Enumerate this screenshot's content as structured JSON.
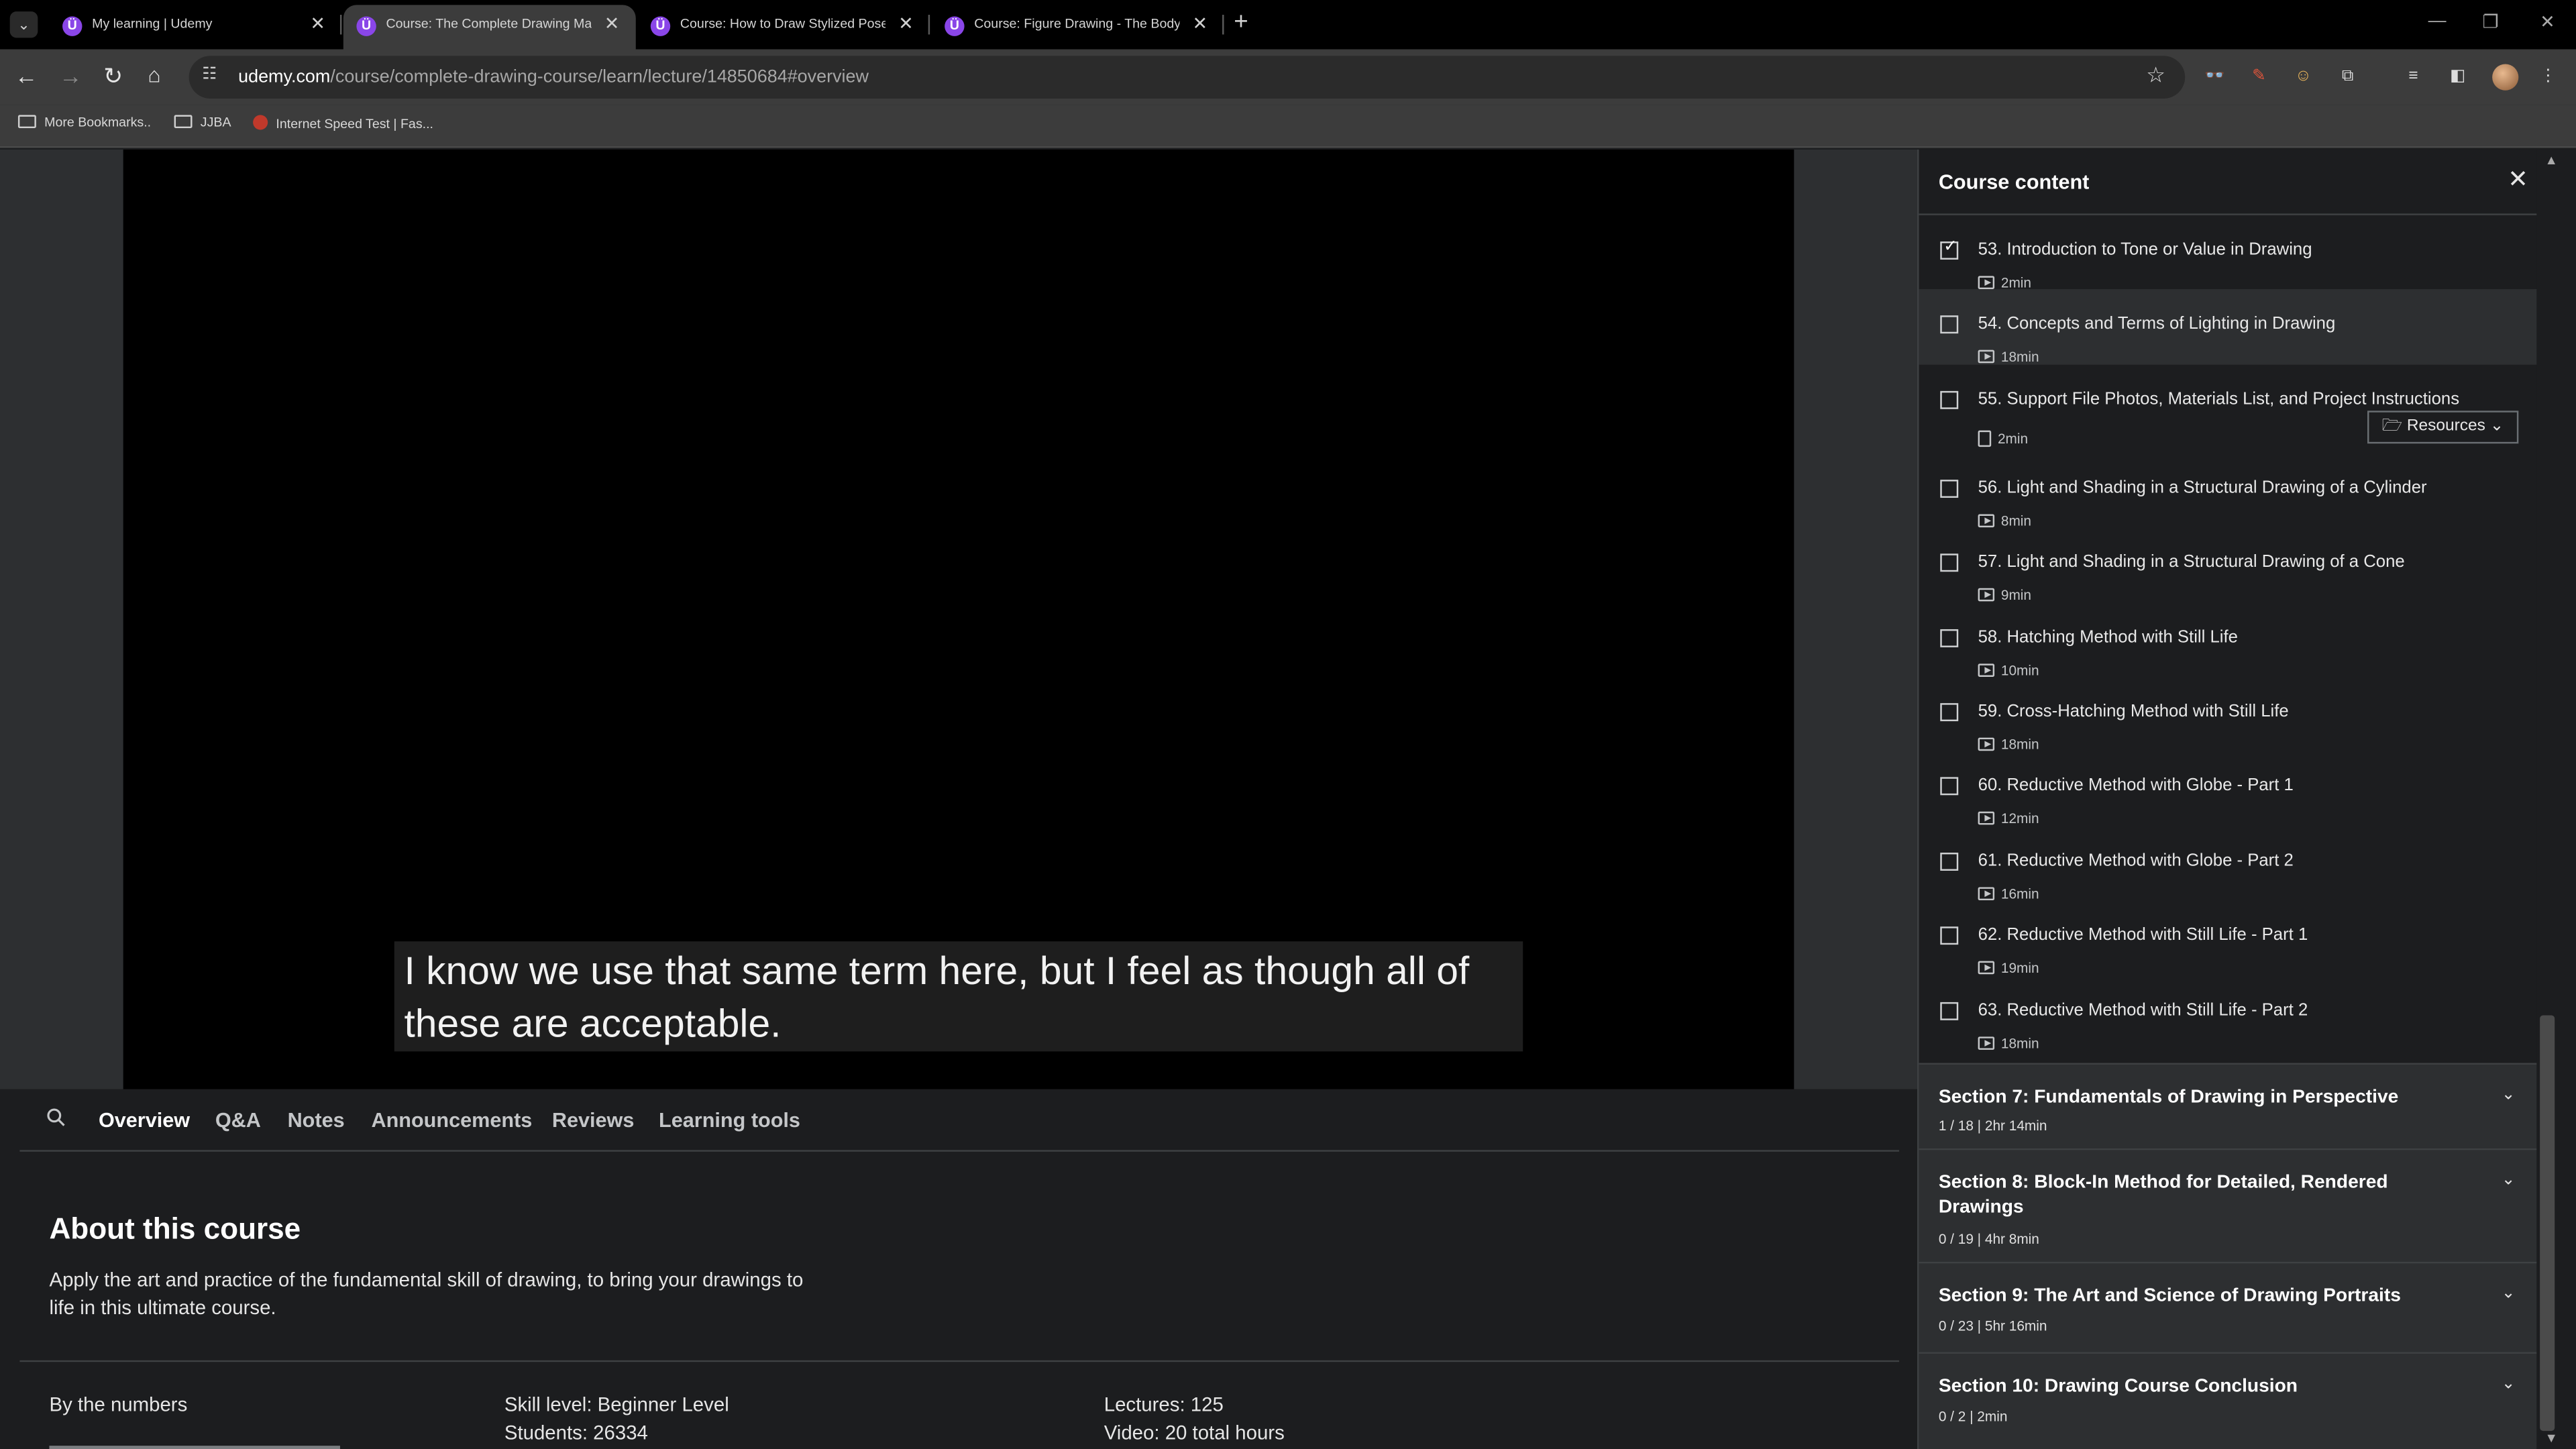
{
  "browser": {
    "tabs": [
      {
        "title": "My learning | Udemy",
        "active": false
      },
      {
        "title": "Course: The Complete Drawing Maste",
        "active": true
      },
      {
        "title": "Course: How to Draw Stylized Poses a",
        "active": false
      },
      {
        "title": "Course: Figure Drawing - The Body in",
        "active": false
      }
    ],
    "url_host": "udemy.com",
    "url_path": "/course/complete-drawing-course/learn/lecture/14850684#overview",
    "bookmarks": [
      "More Bookmarks..",
      "JJBA",
      "Internet Speed Test | Fas..."
    ]
  },
  "video": {
    "caption": "I know we use that same term here, but I feel as though all of these are acceptable."
  },
  "lower_tabs": [
    "Overview",
    "Q&A",
    "Notes",
    "Announcements",
    "Reviews",
    "Learning tools"
  ],
  "about": {
    "title": "About this course",
    "description": "Apply the art and practice of the fundamental skill of drawing, to bring your drawings to life in this ultimate course.",
    "by_numbers_label": "By the numbers",
    "skill_level": "Skill level: Beginner Level",
    "students": "Students: 26334",
    "lectures": "Lectures: 125",
    "video": "Video: 20 total hours"
  },
  "sidebar": {
    "title": "Course content",
    "lectures": [
      {
        "title": "53. Introduction to Tone or Value in Drawing",
        "duration": "2min",
        "type": "video",
        "checked": true
      },
      {
        "title": "54. Concepts and Terms of Lighting in Drawing",
        "duration": "18min",
        "type": "video",
        "checked": false
      },
      {
        "title": "55. Support File Photos, Materials List, and Project Instructions",
        "duration": "2min",
        "type": "file",
        "checked": false,
        "resources": "Resources"
      },
      {
        "title": "56. Light and Shading in a Structural Drawing of a Cylinder",
        "duration": "8min",
        "type": "video",
        "checked": false
      },
      {
        "title": "57. Light and Shading in a Structural Drawing of a Cone",
        "duration": "9min",
        "type": "video",
        "checked": false
      },
      {
        "title": "58. Hatching Method with Still Life",
        "duration": "10min",
        "type": "video",
        "checked": false
      },
      {
        "title": "59. Cross-Hatching Method with Still Life",
        "duration": "18min",
        "type": "video",
        "checked": false
      },
      {
        "title": "60. Reductive Method with Globe - Part 1",
        "duration": "12min",
        "type": "video",
        "checked": false
      },
      {
        "title": "61. Reductive Method with Globe - Part 2",
        "duration": "16min",
        "type": "video",
        "checked": false
      },
      {
        "title": "62. Reductive Method with Still Life - Part 1",
        "duration": "19min",
        "type": "video",
        "checked": false
      },
      {
        "title": "63. Reductive Method with Still Life - Part 2",
        "duration": "18min",
        "type": "video",
        "checked": false
      }
    ],
    "sections": [
      {
        "title": "Section 7: Fundamentals of Drawing in Perspective",
        "meta": "1 / 18 | 2hr 14min"
      },
      {
        "title": "Section 8: Block-In Method for Detailed, Rendered Drawings",
        "meta": "0 / 19 | 4hr 8min"
      },
      {
        "title": "Section 9: The Art and Science of Drawing Portraits",
        "meta": "0 / 23 | 5hr 16min"
      },
      {
        "title": "Section 10: Drawing Course Conclusion",
        "meta": "0 / 2 | 2min"
      }
    ]
  }
}
